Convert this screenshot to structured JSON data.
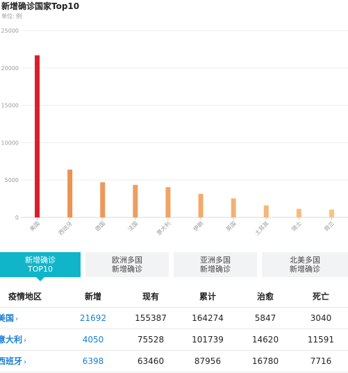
{
  "chart_data": {
    "type": "bar",
    "title": "新增确诊国家Top10",
    "unit_label": "单位: 例",
    "categories": [
      "美国",
      "西班牙",
      "德国",
      "法国",
      "意大利",
      "伊朗",
      "英国",
      "土耳其",
      "瑞士",
      "荷兰"
    ],
    "values": [
      21692,
      6398,
      4700,
      4350,
      4050,
      3150,
      2550,
      1600,
      1150,
      1050
    ],
    "ylim": [
      0,
      25000
    ],
    "yticks": [
      "0",
      "5000",
      "10000",
      "15000",
      "20000",
      "25000"
    ],
    "grid": true,
    "colors": {
      "top": "#d7202a",
      "rest_from": "#ec9252",
      "rest_to": "#f7c383",
      "axis": "#dddddd"
    }
  },
  "tabs": [
    {
      "line1": "新增确诊",
      "line2": "TOP10",
      "active": true
    },
    {
      "line1": "欧洲多国",
      "line2": "新增确诊",
      "active": false
    },
    {
      "line1": "亚洲多国",
      "line2": "新增确诊",
      "active": false
    },
    {
      "line1": "北美多国",
      "line2": "新增确诊",
      "active": false
    }
  ],
  "table": {
    "headers": {
      "region": "疫情地区",
      "new": "新增",
      "current": "现有",
      "cumulative": "累计",
      "cured": "治愈",
      "dead": "死亡"
    },
    "rows": [
      {
        "region": "美国",
        "new": "21692",
        "current": "155387",
        "cumulative": "164274",
        "cured": "5847",
        "dead": "3040"
      },
      {
        "region": "意大利",
        "new": "4050",
        "current": "75528",
        "cumulative": "101739",
        "cured": "14620",
        "dead": "11591"
      },
      {
        "region": "西班牙",
        "new": "6398",
        "current": "63460",
        "cumulative": "87956",
        "cured": "16780",
        "dead": "7716"
      }
    ],
    "chevron": "›"
  }
}
